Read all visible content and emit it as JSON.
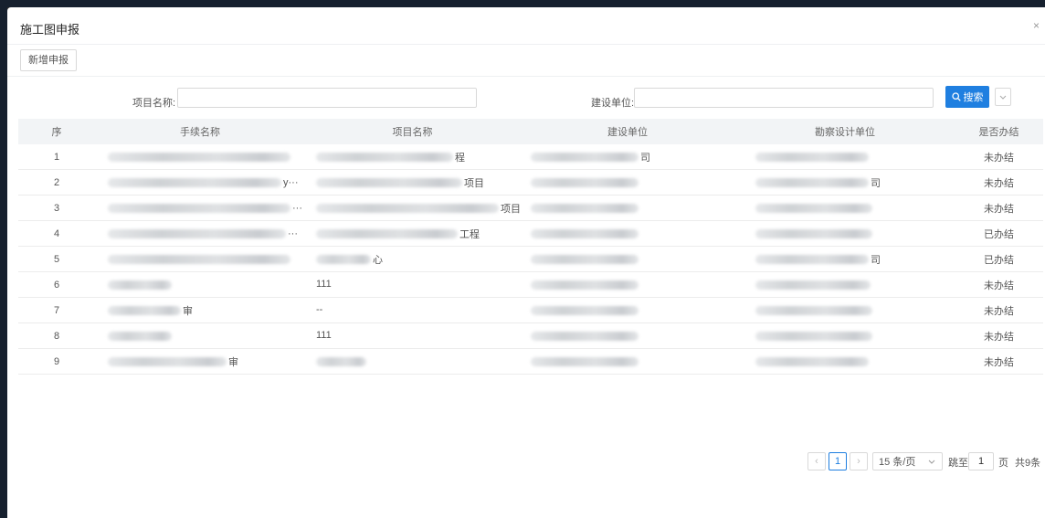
{
  "modal": {
    "title": "施工图申报",
    "close_label": "×"
  },
  "toolbar": {
    "new_button": "新增申报"
  },
  "search": {
    "project_name_label": "项目名称:",
    "project_name_value": "",
    "unit_label": "建设单位:",
    "unit_value": "",
    "search_button": "搜索"
  },
  "table": {
    "columns": [
      "序",
      "手续名称",
      "项目名称",
      "建设单位",
      "勘察设计单位",
      "是否办结"
    ],
    "rows": [
      {
        "seq": "1",
        "proc_suffix": "",
        "proj": "",
        "proj_suffix": "程",
        "unit_suffix": "司",
        "design_suffix": "",
        "status": "未办结"
      },
      {
        "seq": "2",
        "proc_suffix": "y···",
        "proj": "",
        "proj_suffix": "项目",
        "unit_suffix": "",
        "design_suffix": "司",
        "status": "未办结"
      },
      {
        "seq": "3",
        "proc_suffix": "···",
        "proj": "",
        "proj_suffix": "项目",
        "unit_suffix": "",
        "design_suffix": "",
        "status": "未办结"
      },
      {
        "seq": "4",
        "proc_suffix": "···",
        "proj": "",
        "proj_suffix": "工程",
        "unit_suffix": "",
        "design_suffix": "",
        "status": "已办结"
      },
      {
        "seq": "5",
        "proc_suffix": "",
        "proj": "",
        "proj_suffix": "心",
        "unit_suffix": "",
        "design_suffix": "司",
        "status": "已办结"
      },
      {
        "seq": "6",
        "proc_suffix": "",
        "proj": "111",
        "proj_suffix": "",
        "unit_suffix": "",
        "design_suffix": "",
        "status": "未办结"
      },
      {
        "seq": "7",
        "proc_suffix": "审",
        "proj": "--",
        "proj_suffix": "",
        "unit_suffix": "",
        "design_suffix": "",
        "status": "未办结"
      },
      {
        "seq": "8",
        "proc_suffix": "",
        "proj": "111",
        "proj_suffix": "",
        "unit_suffix": "",
        "design_suffix": "",
        "status": "未办结"
      },
      {
        "seq": "9",
        "proc_suffix": "审",
        "proj": "",
        "proj_suffix": "",
        "unit_suffix": "",
        "design_suffix": "",
        "status": "未办结"
      }
    ]
  },
  "pagination": {
    "prev": "‹",
    "current": "1",
    "next": "›",
    "page_size": "15 条/页",
    "goto_label": "跳至",
    "goto_value": "1",
    "page_unit": "页",
    "total": "共9条"
  }
}
